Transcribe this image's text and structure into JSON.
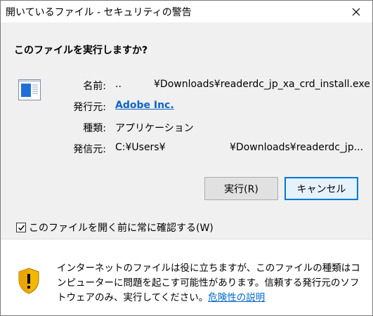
{
  "window": {
    "title": "開いているファイル - セキュリティの警告",
    "close_label": "×"
  },
  "dialog": {
    "question": "このファイルを実行しますか?",
    "icon": "application-window-icon",
    "fields": {
      "name_label": "名前:",
      "name_value_prefix": "..",
      "name_value": "¥Downloads¥readerdc_jp_xa_crd_install.exe",
      "publisher_label": "発行元:",
      "publisher_value": "Adobe Inc.",
      "type_label": "種類:",
      "type_value": "アプリケーション",
      "from_label": "発信元:",
      "from_value_prefix": "C:¥Users¥",
      "from_value": "¥Downloads¥readerdc_jp..."
    },
    "buttons": {
      "run": "実行(R)",
      "cancel": "キャンセル"
    },
    "checkbox": {
      "label": "このファイルを開く前に常に確認する(W)",
      "checked": true
    }
  },
  "footer": {
    "icon": "shield-warning-icon",
    "warning_text": "インターネットのファイルは役に立ちますが、このファイルの種類はコンピューターに問題を起こす可能性があります。信頼する発行元のソフトウェアのみ、実行してください。",
    "link_text": "危険性の説明"
  },
  "colors": {
    "accent": "#0078d7",
    "link": "#0066cc",
    "shield": "#f5b800"
  }
}
